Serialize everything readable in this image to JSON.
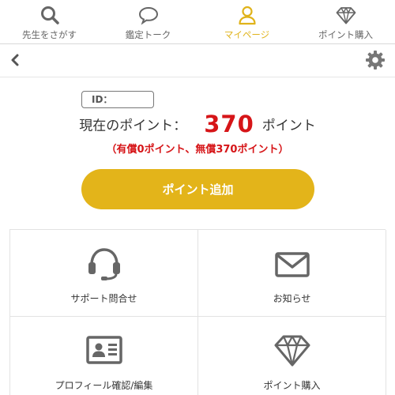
{
  "tabs": [
    {
      "label": "先生をさがす",
      "icon": "search-icon",
      "active": false
    },
    {
      "label": "鑑定トーク",
      "icon": "chat-bubble-icon",
      "active": false
    },
    {
      "label": "マイページ",
      "icon": "person-icon",
      "active": true
    },
    {
      "label": "ポイント購入",
      "icon": "diamond-icon",
      "active": false
    }
  ],
  "header": {
    "back_icon": "chevron-left-icon",
    "settings_icon": "gear-icon"
  },
  "account": {
    "id_label": "ID："
  },
  "points": {
    "label": "現在のポイント：",
    "value": "370",
    "unit": "ポイント",
    "breakdown": "（有償0ポイント、無償370ポイント）"
  },
  "add_button_label": "ポイント追加",
  "menu": [
    {
      "label": "サポート問合せ",
      "icon": "headset-icon"
    },
    {
      "label": "お知らせ",
      "icon": "envelope-icon"
    },
    {
      "label": "プロフィール確認/編集",
      "icon": "id-card-icon"
    },
    {
      "label": "ポイント購入",
      "icon": "diamond-icon"
    }
  ],
  "colors": {
    "accent": "#e3b41a",
    "points_red": "#d61518",
    "icon_gray": "#666666"
  }
}
